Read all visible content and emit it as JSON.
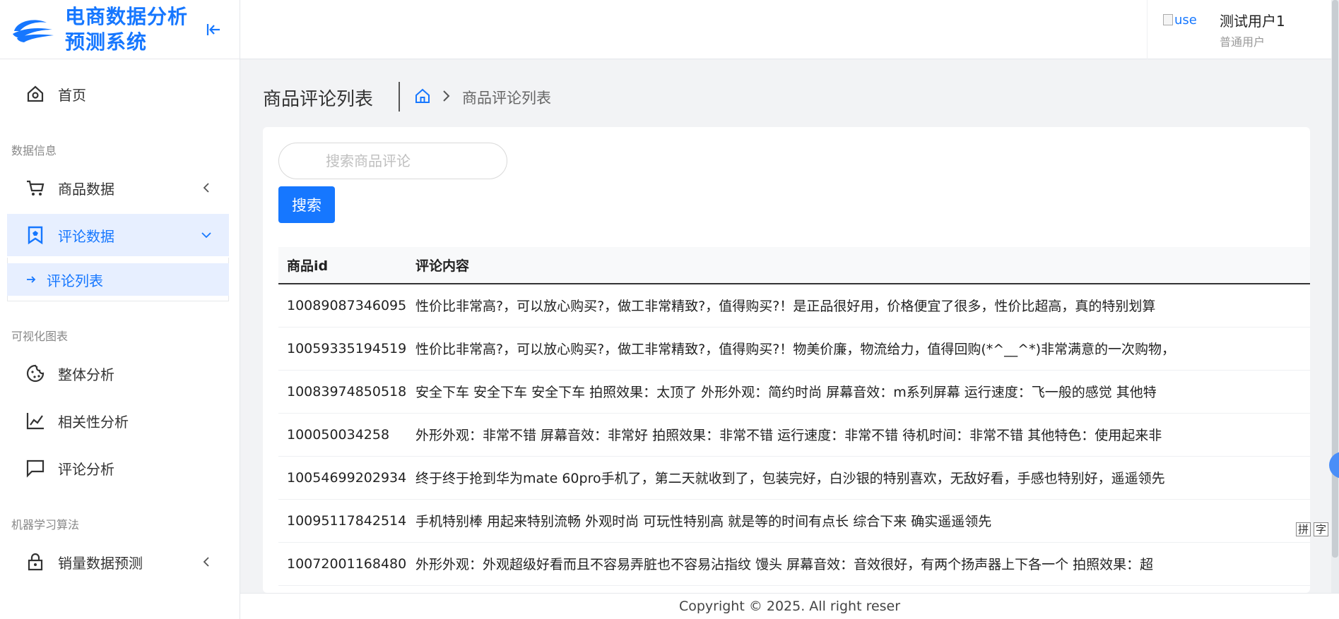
{
  "app": {
    "title_line1": "电商数据分析",
    "title_line2": "预测系统",
    "accent_color": "#1677ff"
  },
  "sidebar": {
    "home_label": "首页",
    "sections": {
      "data_info": "数据信息",
      "charts": "可视化图表",
      "ml": "机器学习算法"
    },
    "items": {
      "product_data": "商品数据",
      "comment_data": "评论数据",
      "comment_list": "评论列表",
      "overall_analysis": "整体分析",
      "correlation_analysis": "相关性分析",
      "comment_analysis": "评论分析",
      "sales_forecast": "销量数据预测"
    }
  },
  "header": {
    "avatar_alt": "use",
    "user_name": "测试用户1",
    "user_role": "普通用户"
  },
  "page": {
    "title": "商品评论列表",
    "breadcrumb_current": "商品评论列表"
  },
  "search": {
    "placeholder": "搜索商品评论",
    "value": "",
    "button_label": "搜索"
  },
  "table": {
    "columns": [
      "商品id",
      "评论内容"
    ],
    "rows": [
      {
        "id": "10089087346095",
        "content": "性价比非常高?，可以放心购买?，做工非常精致?，值得购买?！是正品很好用，价格便宜了很多，性价比超高，真的特别划算"
      },
      {
        "id": "10059335194519",
        "content": "性价比非常高?，可以放心购买?，做工非常精致?，值得购买?！物美价廉，物流给力，值得回购(*^__^*)非常满意的一次购物，"
      },
      {
        "id": "10083974850518",
        "content": "安全下车 安全下车 安全下车 拍照效果：太顶了 外形外观：简约时尚 屏幕音效：m系列屏幕 运行速度：飞一般的感觉 其他特"
      },
      {
        "id": "100050034258",
        "content": "外形外观：非常不错 屏幕音效：非常好 拍照效果：非常不错 运行速度：非常不错 待机时间：非常不错 其他特色：使用起来非"
      },
      {
        "id": "10054699202934",
        "content": "终于终于抢到华为mate 60pro手机了，第二天就收到了，包装完好，白沙银的特别喜欢，无敌好看，手感也特别好，遥遥领先"
      },
      {
        "id": "10095117842514",
        "content": "手机特别棒 用起来特别流畅 外观时尚 可玩性特别高 就是等的时间有点长 综合下来 确实遥遥领先"
      },
      {
        "id": "10072001168480",
        "content": "外形外观：外观超级好看而且不容易弄脏也不容易沾指纹 馒头 屏幕音效：音效很好，有两个扬声器上下各一个 拍照效果：超"
      },
      {
        "id": "",
        "content": ""
      }
    ]
  },
  "footer": {
    "copyright": "Copyright © 2025. All right reser"
  },
  "ime": {
    "key1": "拼",
    "key2": "字"
  }
}
